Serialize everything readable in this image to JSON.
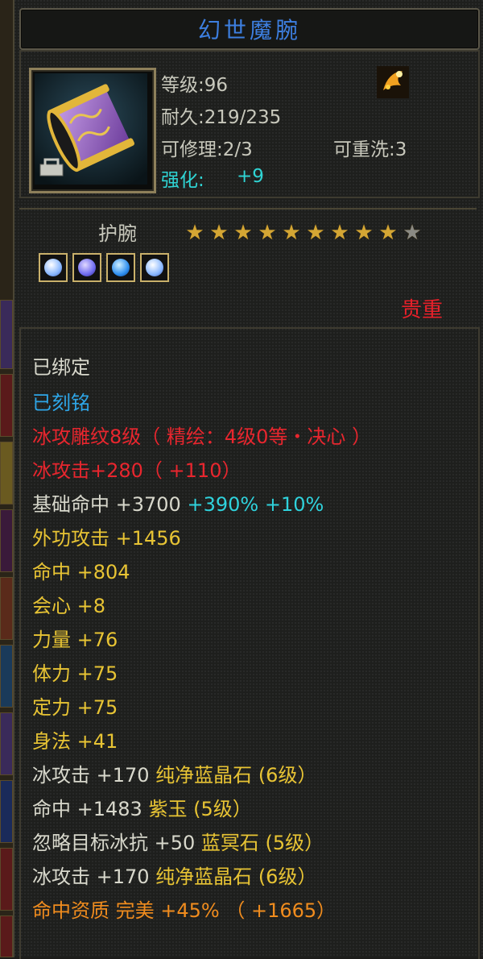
{
  "item": {
    "name": "幻世魔腕",
    "level": "等级:96",
    "durability": "耐久:219/235",
    "repairable": "可修理:2/3",
    "rewash": "可重洗:3",
    "enhance_label": "强化:",
    "enhance_value": "+9",
    "type": "护腕",
    "rarity": "贵重",
    "stars_filled": 9,
    "stars_total": 10
  },
  "icons": [
    "bracer-icon",
    "lock-icon",
    "sparkle-icon",
    "gem-icon"
  ],
  "gems": [
    {
      "name": "gem-slot-1",
      "color": "#b8d6ff"
    },
    {
      "name": "gem-slot-2",
      "color": "#6f6cf0"
    },
    {
      "name": "gem-slot-3",
      "color": "#2f8ff0"
    },
    {
      "name": "gem-slot-4",
      "color": "#b8d6ff"
    }
  ],
  "attributes": {
    "bound": "已绑定",
    "engraved": "已刻铭",
    "carving": "冰攻雕纹8级（ 精绘：4级0等・决心 ）",
    "ice_attack": "冰攻击+280（ +110）",
    "base_hit_label": "基础命中 +3700",
    "base_hit_pct": "+390%",
    "base_hit_pct2": "+10%",
    "ext_attack": "外功攻击 +1456",
    "hit": "命中 +804",
    "crit": "会心 +8",
    "strength": "力量 +76",
    "stamina": "体力 +75",
    "focus": "定力 +75",
    "agility": "身法 +41",
    "gem1_stat": "冰攻击 +170",
    "gem1_name": "纯净蓝晶石 (6级）",
    "gem2_stat": "命中 +1483",
    "gem2_name": "紫玉 (5级）",
    "gem3_stat": "忽略目标冰抗 +50",
    "gem3_name": "蓝冥石 (5级）",
    "gem4_stat": "冰攻击 +170",
    "gem4_name": "纯净蓝晶石 (6级）",
    "aptitude": "命中资质 完美 +45% （ +1665）"
  }
}
